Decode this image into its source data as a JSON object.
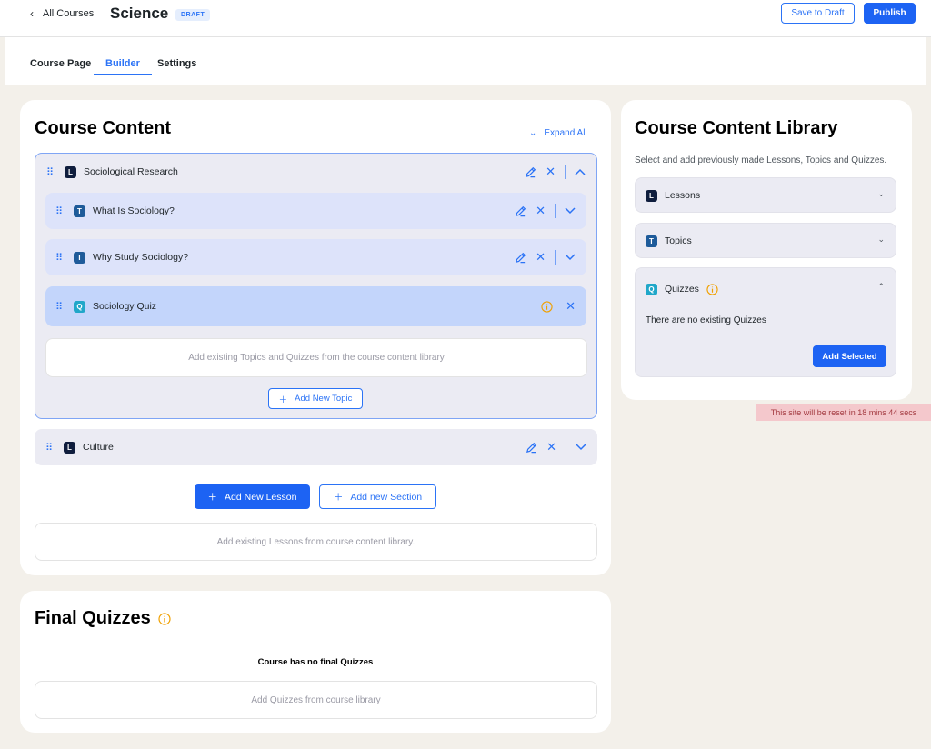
{
  "header": {
    "back_label": "All Courses",
    "course_title": "Science",
    "status_badge": "DRAFT",
    "save_draft_label": "Save to Draft",
    "publish_label": "Publish"
  },
  "tabs": [
    {
      "label": "Course Page",
      "active": false
    },
    {
      "label": "Builder",
      "active": true
    },
    {
      "label": "Settings",
      "active": false
    }
  ],
  "course_content": {
    "title": "Course Content",
    "expand_all_label": "Expand All",
    "lessons": [
      {
        "badge": "L",
        "title": "Sociological Research",
        "expanded": true,
        "items": [
          {
            "badge": "T",
            "title": "What Is Sociology?"
          },
          {
            "badge": "T",
            "title": "Why Study Sociology?"
          },
          {
            "badge": "Q",
            "title": "Sociology Quiz"
          }
        ],
        "drop_hint": "Add existing Topics and Quizzes from the course content library",
        "add_topic_label": "Add New Topic"
      },
      {
        "badge": "L",
        "title": "Culture",
        "expanded": false
      }
    ],
    "add_lesson_label": "Add New Lesson",
    "add_section_label": "Add new Section",
    "lessons_drop_hint": "Add existing Lessons from course content library."
  },
  "final_quizzes": {
    "title": "Final Quizzes",
    "empty_text": "Course has no final Quizzes",
    "drop_hint": "Add Quizzes from course library"
  },
  "library": {
    "title": "Course Content Library",
    "description": "Select and add previously made Lessons, Topics and Quizzes.",
    "sections": [
      {
        "badge": "L",
        "label": "Lessons",
        "expanded": false
      },
      {
        "badge": "T",
        "label": "Topics",
        "expanded": false
      },
      {
        "badge": "Q",
        "label": "Quizzes",
        "expanded": true,
        "empty_text": "There are no existing Quizzes"
      }
    ],
    "add_selected_label": "Add Selected"
  },
  "reset_notice": "This site will be reset in 18 mins 44 secs",
  "colors": {
    "accent": "#2b73f6",
    "page_bg": "#f3f0ea",
    "row_bg": "#dde3fa",
    "active_row_bg": "#c3d5fb",
    "warning": "#f0a000",
    "reset_bg": "#f4c8cc"
  },
  "icons": {
    "drag": "grip-dots-icon",
    "edit": "pencil-icon",
    "delete": "close-icon",
    "collapse": "chevron-up-icon",
    "expand": "chevron-down-icon",
    "info": "info-circle-icon",
    "add": "plus-icon"
  }
}
